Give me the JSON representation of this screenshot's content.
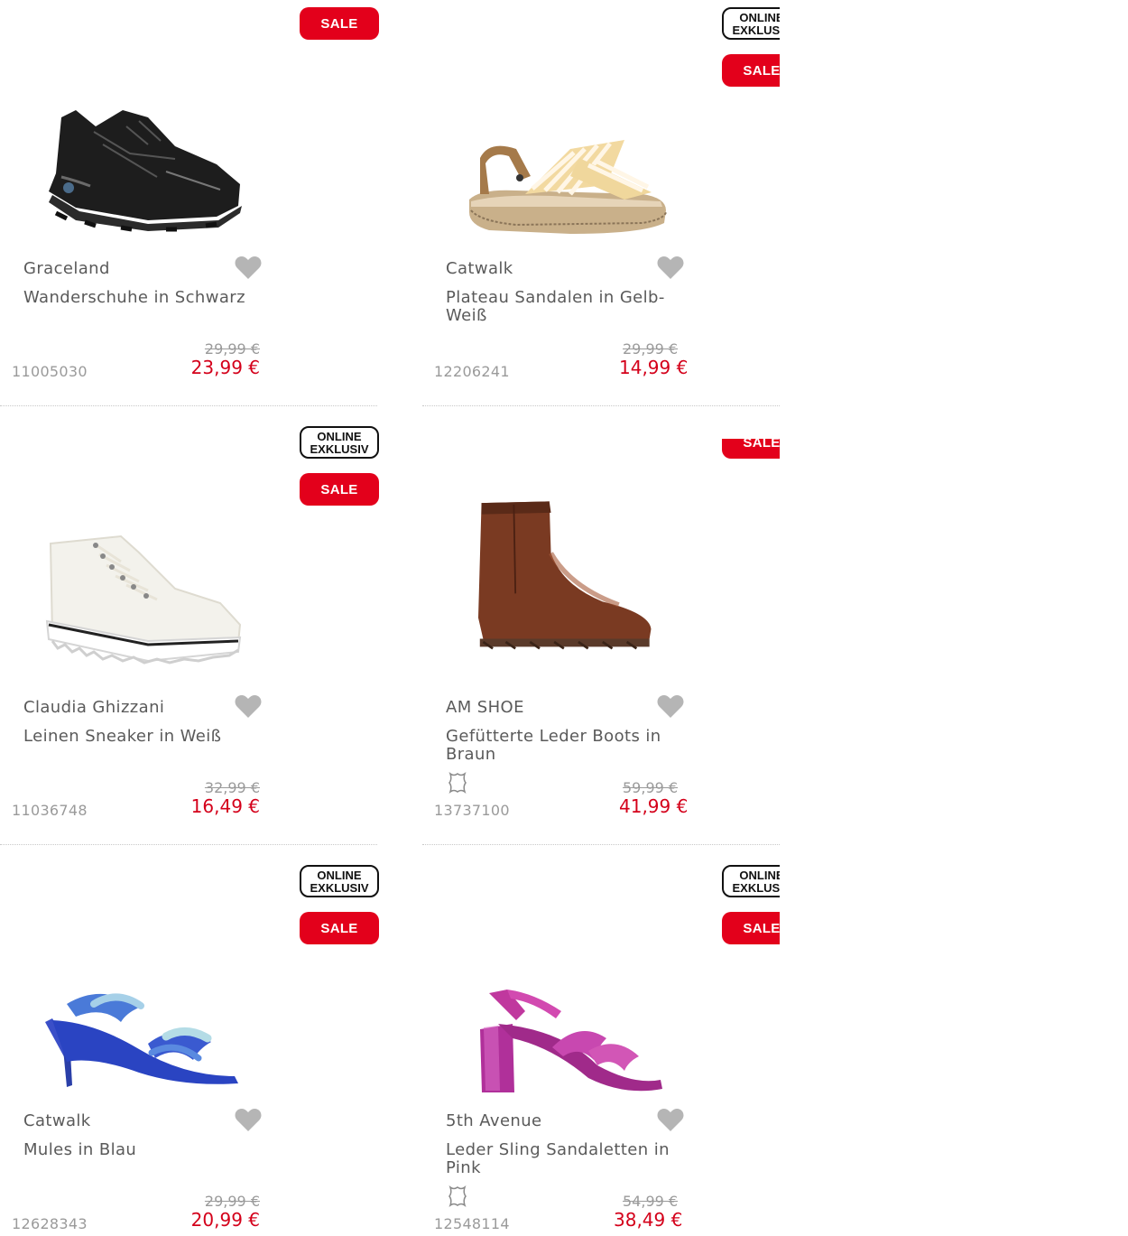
{
  "colors": {
    "sale_badge": "#e3001b",
    "price_red": "#d4001a",
    "text_gray": "#5a5a5a",
    "heart_gray": "#b5b5b5"
  },
  "badges": {
    "sale": "SALE",
    "online_line1": "ONLINE",
    "online_line2": "EXKLUSIV"
  },
  "products": [
    {
      "brand": "Graceland",
      "name": "Wanderschuhe in Schwarz",
      "article_no": "11005030",
      "old_price": "29,99 €",
      "new_price": "23,99 €",
      "badges": [
        "sale"
      ],
      "leather_icon": false,
      "image": "black-hiking-shoe-image",
      "wishlist_icon": "heart-icon"
    },
    {
      "brand": "Catwalk",
      "name": "Plateau Sandalen in Gelb-Weiß",
      "article_no": "12206241",
      "old_price": "29,99 €",
      "new_price": "14,99 €",
      "badges": [
        "online",
        "sale"
      ],
      "leather_icon": false,
      "image": "striped-platform-sandal-image",
      "wishlist_icon": "heart-icon"
    },
    {
      "brand": "Claudia Ghizzani",
      "name": "Leinen Sneaker in Weiß",
      "article_no": "11036748",
      "old_price": "32,99 €",
      "new_price": "16,49 €",
      "badges": [
        "online",
        "sale"
      ],
      "leather_icon": false,
      "image": "white-high-top-sneaker-image",
      "wishlist_icon": "heart-icon"
    },
    {
      "brand": "AM SHOE",
      "name": "Gefütterte Leder Boots in Braun",
      "article_no": "13737100",
      "old_price": "59,99 €",
      "new_price": "41,99 €",
      "badges": [
        "sale"
      ],
      "leather_icon": true,
      "image": "brown-leather-boot-image",
      "wishlist_icon": "heart-icon"
    },
    {
      "brand": "Catwalk",
      "name": "Mules in Blau",
      "article_no": "12628343",
      "old_price": "29,99 €",
      "new_price": "20,99 €",
      "badges": [
        "online",
        "sale"
      ],
      "leather_icon": false,
      "image": "blue-metallic-mule-image",
      "wishlist_icon": "heart-icon"
    },
    {
      "brand": "5th Avenue",
      "name": "Leder Sling Sandaletten in Pink",
      "article_no": "12548114",
      "old_price": "54,99 €",
      "new_price": "38,49 €",
      "badges": [
        "online",
        "sale"
      ],
      "leather_icon": true,
      "image": "pink-metallic-sandal-image",
      "wishlist_icon": "heart-icon"
    }
  ]
}
